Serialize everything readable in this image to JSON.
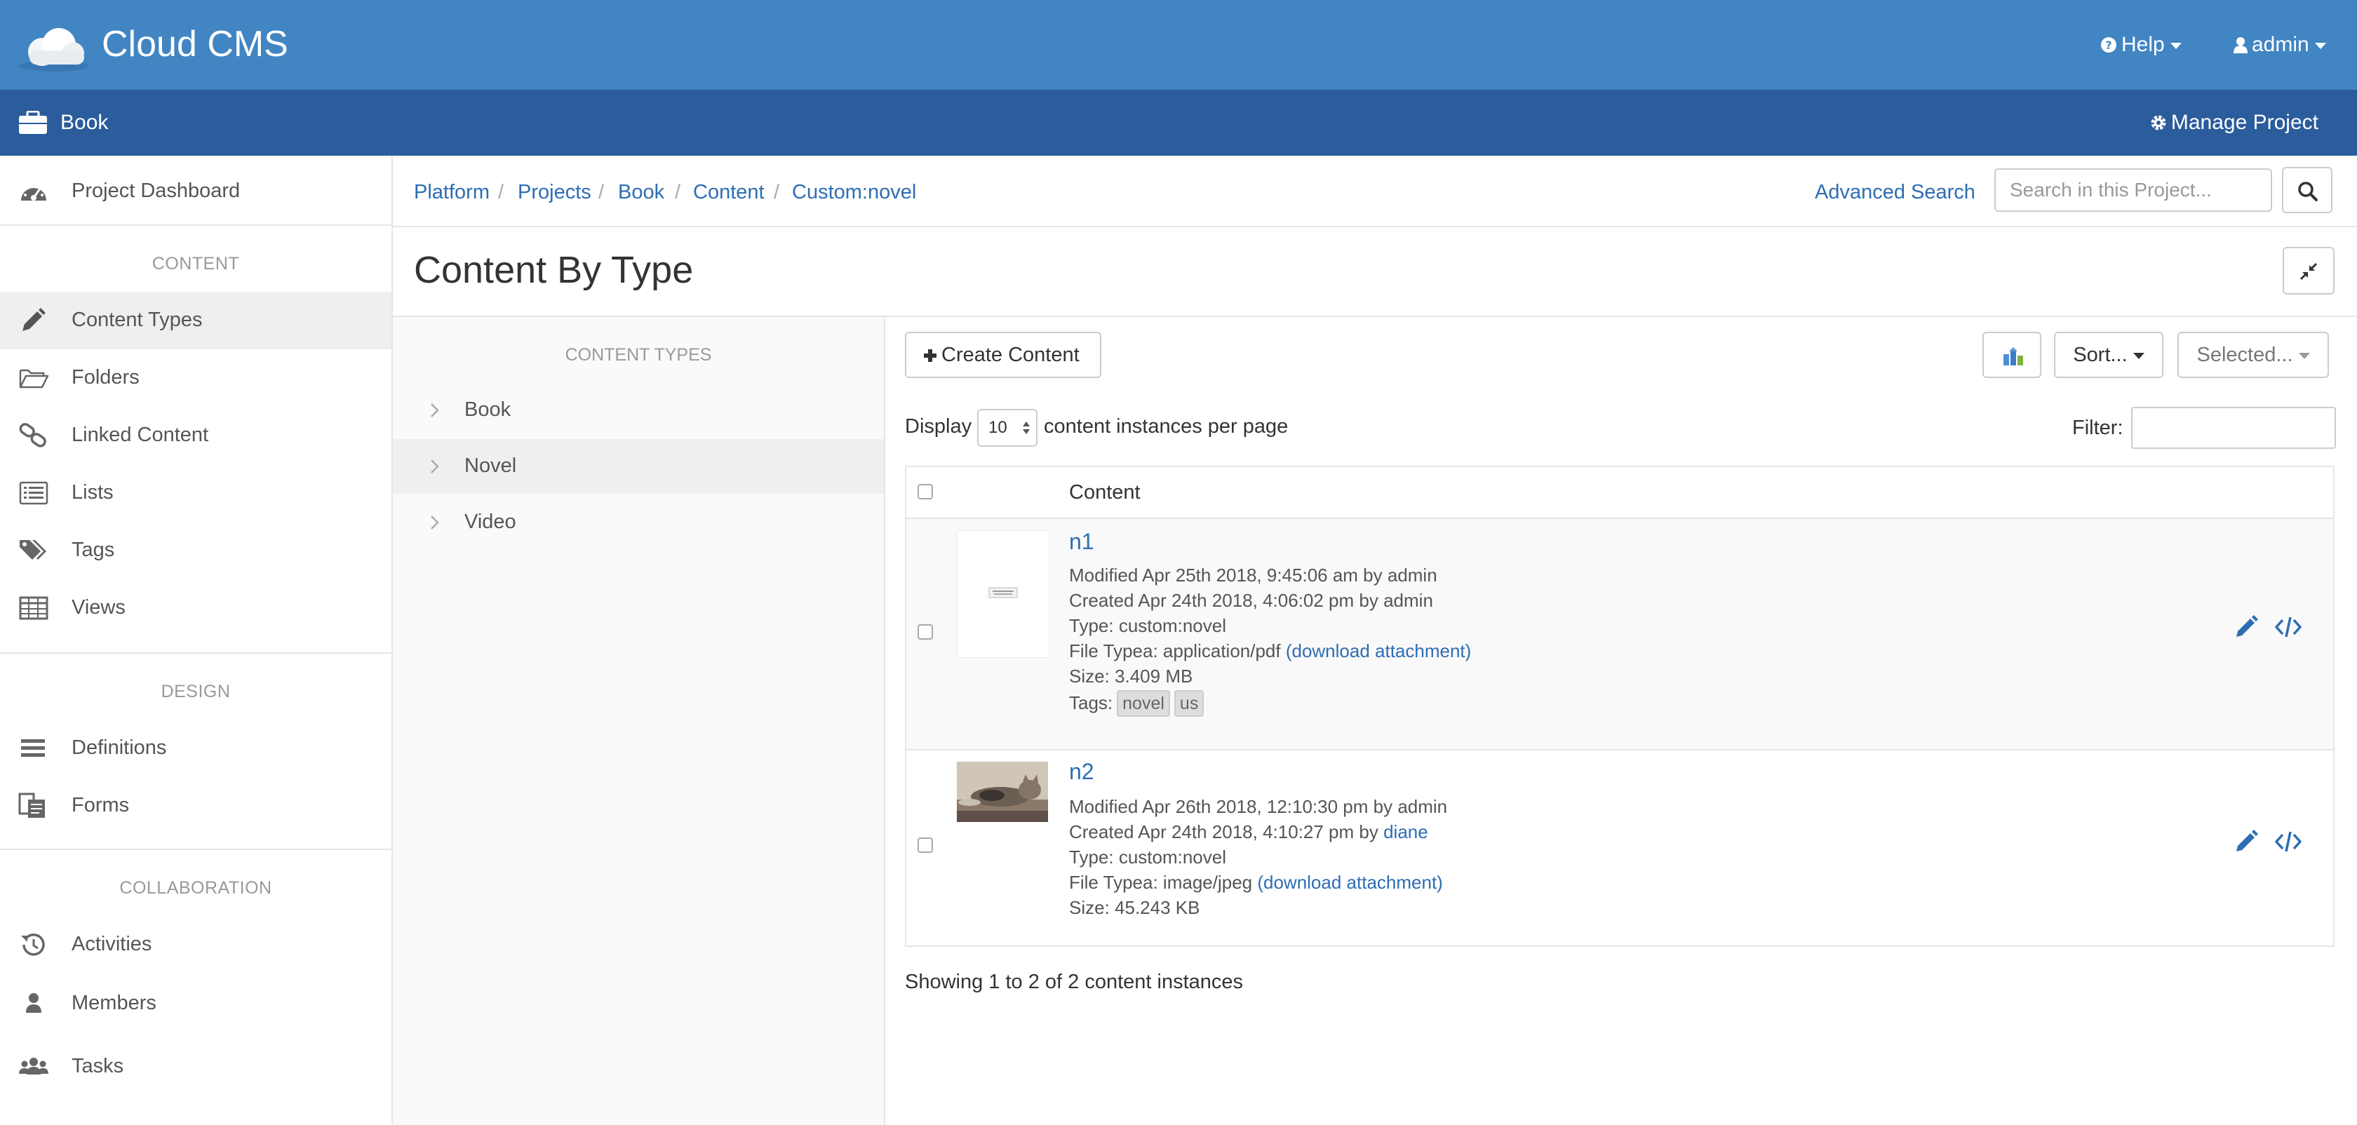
{
  "app": {
    "title": "Cloud CMS"
  },
  "topnav": {
    "help": "Help",
    "user": "admin"
  },
  "project": {
    "name": "Book",
    "manage": "Manage Project"
  },
  "sidebar": {
    "dashboard": "Project Dashboard",
    "sections": [
      {
        "heading": "CONTENT",
        "items": [
          "Content Types",
          "Folders",
          "Linked Content",
          "Lists",
          "Tags",
          "Views"
        ]
      },
      {
        "heading": "DESIGN",
        "items": [
          "Definitions",
          "Forms"
        ]
      },
      {
        "heading": "COLLABORATION",
        "items": [
          "Activities",
          "Members",
          "Tasks"
        ]
      }
    ],
    "active": "Content Types"
  },
  "breadcrumb": [
    "Platform",
    "Projects",
    "Book",
    "Content",
    "Custom:novel"
  ],
  "search": {
    "advanced": "Advanced Search",
    "placeholder": "Search in this Project..."
  },
  "page": {
    "title": "Content By Type"
  },
  "content_types": {
    "heading": "CONTENT TYPES",
    "items": [
      "Book",
      "Novel",
      "Video"
    ],
    "active": "Novel"
  },
  "toolbar": {
    "create": "Create Content",
    "sort": "Sort...",
    "selected": "Selected..."
  },
  "pagination": {
    "display": "Display",
    "per_page_value": "10",
    "per_page_suffix": "content instances per page",
    "filter_label": "Filter:"
  },
  "table": {
    "header": "Content",
    "rows": [
      {
        "title": "n1",
        "modified": "Modified Apr 25th 2018, 9:45:06 am by admin",
        "created_prefix": "Created Apr 24th 2018, 4:06:02 pm by ",
        "created_by": "admin",
        "type": "Type: custom:novel",
        "file_prefix": "File Typea: application/pdf ",
        "download": "(download attachment)",
        "size": "Size: 3.409 MB",
        "tags_label": "Tags:",
        "tags": [
          "novel",
          "us"
        ]
      },
      {
        "title": "n2",
        "modified": "Modified Apr 26th 2018, 12:10:30 pm by admin",
        "created_prefix": "Created Apr 24th 2018, 4:10:27 pm by ",
        "created_by": "diane",
        "type": "Type: custom:novel",
        "file_prefix": "File Typea: image/jpeg ",
        "download": "(download attachment)",
        "size": "Size: 45.243 KB"
      }
    ]
  },
  "footer": {
    "showing": "Showing 1 to 2 of 2 content instances"
  },
  "colors": {
    "topbar": "#4185c2",
    "projectbar": "#2b5c9c",
    "link": "#2d6db4"
  }
}
